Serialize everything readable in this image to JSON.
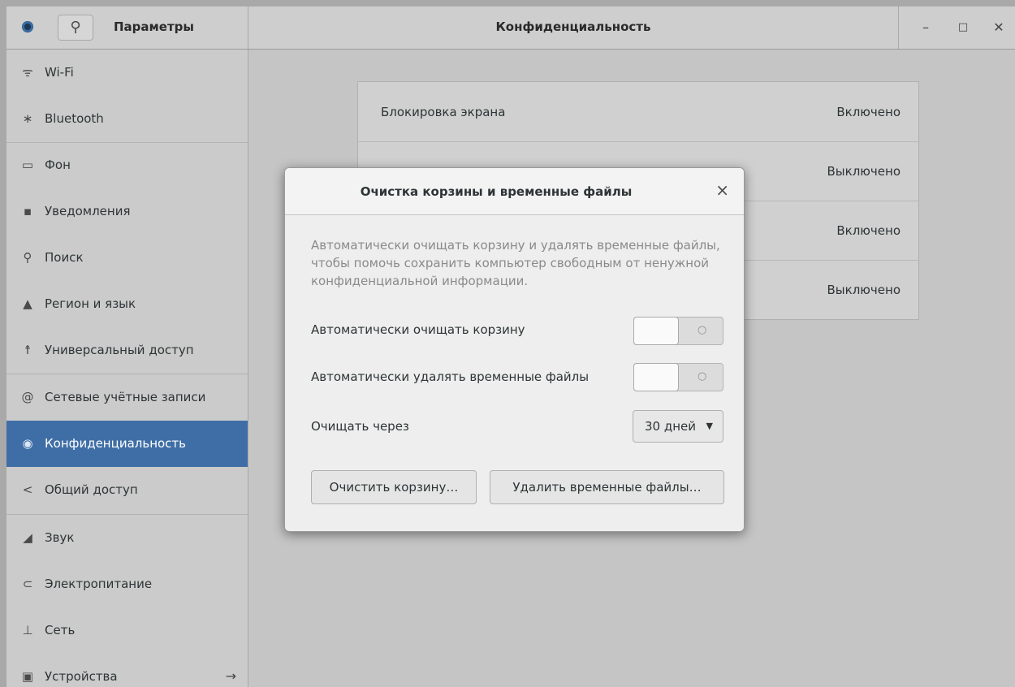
{
  "header": {
    "app_title": "Параметры",
    "page_title": "Конфиденциальность",
    "minimize": "–",
    "maximize": "□",
    "close": "✕"
  },
  "sidebar": {
    "items": [
      {
        "label": "Wi-Fi",
        "icon": "wifi-icon",
        "glyph": "ᯤ"
      },
      {
        "label": "Bluetooth",
        "icon": "bluetooth-icon",
        "glyph": "∗"
      },
      {
        "label": "Фон",
        "icon": "background-icon",
        "glyph": "▭"
      },
      {
        "label": "Уведомления",
        "icon": "notifications-icon",
        "glyph": "▪"
      },
      {
        "label": "Поиск",
        "icon": "search-icon",
        "glyph": "⚲"
      },
      {
        "label": "Регион и язык",
        "icon": "region-icon",
        "glyph": "▲"
      },
      {
        "label": "Универсальный доступ",
        "icon": "accessibility-icon",
        "glyph": "☨"
      },
      {
        "label": "Сетевые учётные записи",
        "icon": "online-accounts-icon",
        "glyph": "@"
      },
      {
        "label": "Конфиденциальность",
        "icon": "privacy-icon",
        "glyph": "◉"
      },
      {
        "label": "Общий доступ",
        "icon": "sharing-icon",
        "glyph": "<"
      },
      {
        "label": "Звук",
        "icon": "sound-icon",
        "glyph": "◢"
      },
      {
        "label": "Электропитание",
        "icon": "power-icon",
        "glyph": "⊂"
      },
      {
        "label": "Сеть",
        "icon": "network-icon",
        "glyph": "⊥"
      },
      {
        "label": "Устройства",
        "icon": "devices-icon",
        "glyph": "▣",
        "arrow": "→"
      }
    ],
    "selected": "Конфиденциальность"
  },
  "privacy_list": {
    "rows": [
      {
        "label": "Блокировка экрана",
        "value": "Включено"
      },
      {
        "label": "",
        "value": "Выключено"
      },
      {
        "label": "",
        "value": "Включено"
      },
      {
        "label": "",
        "value": "Выключено"
      }
    ]
  },
  "dialog": {
    "title": "Очистка корзины и временные файлы",
    "close": "×",
    "description": "Автоматически очищать корзину и удалять временные файлы, чтобы помочь сохранить компьютер свободным от ненужной конфиденциальной информации.",
    "auto_empty_trash_label": "Автоматически очищать корзину",
    "auto_empty_trash_state": false,
    "auto_purge_temp_label": "Автоматически удалять временные файлы",
    "auto_purge_temp_state": false,
    "switch_off_mark": "○",
    "purge_after_label": "Очищать через",
    "purge_after_value": "30 дней",
    "empty_trash_button": "Очистить корзину…",
    "purge_temp_button": "Удалить временные файлы…"
  }
}
